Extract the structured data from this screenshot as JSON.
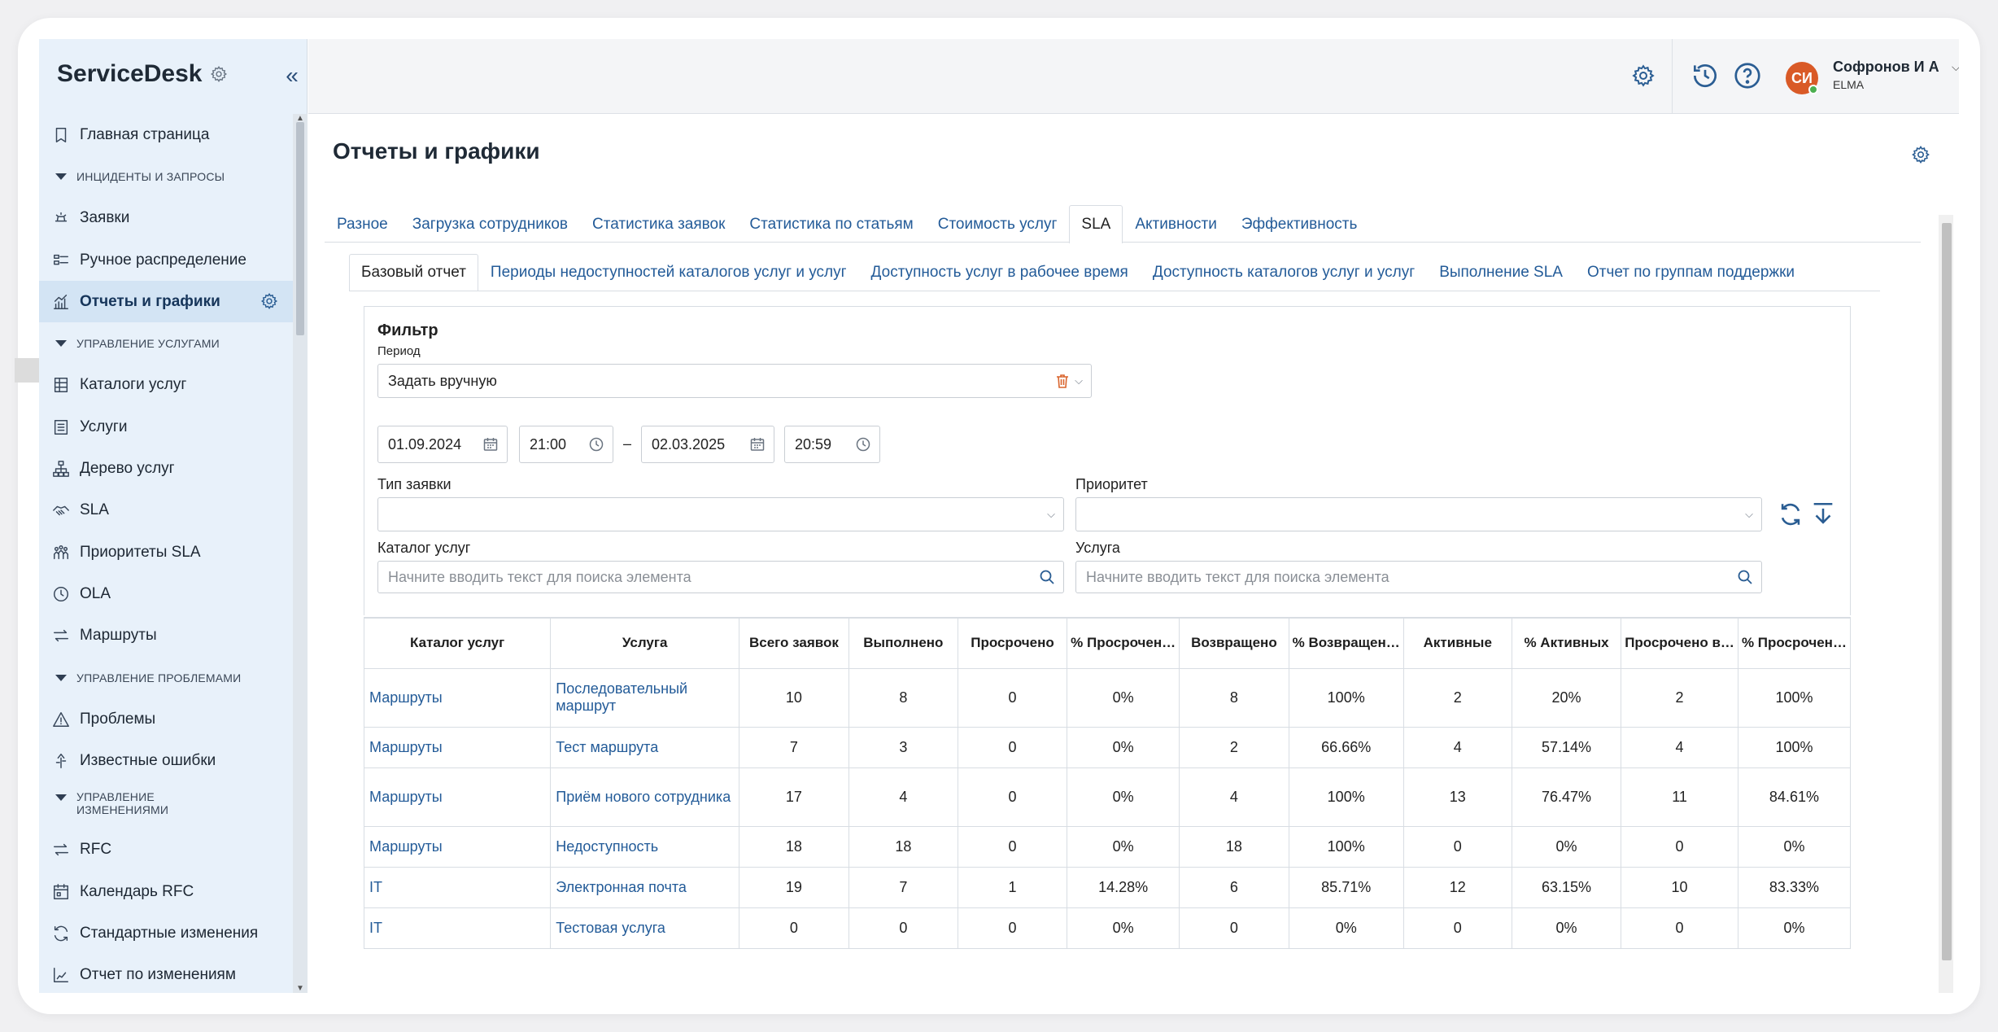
{
  "app": {
    "brand": "ServiceDesk"
  },
  "sidebar": {
    "items": [
      {
        "kind": "item",
        "label": "Главная страница",
        "icon": "bookmark-icon",
        "name": "sidebar-item-home"
      },
      {
        "kind": "section",
        "label": "Инциденты и запросы",
        "name": "sidebar-section-incidents"
      },
      {
        "kind": "item",
        "label": "Заявки",
        "icon": "requests-icon",
        "name": "sidebar-item-requests"
      },
      {
        "kind": "item",
        "label": "Ручное распределение",
        "icon": "distribution-icon",
        "name": "sidebar-item-distribution"
      },
      {
        "kind": "item",
        "label": "Отчеты и графики",
        "icon": "chart-icon",
        "name": "sidebar-item-reports",
        "active": true
      },
      {
        "kind": "section",
        "label": "Управление услугами",
        "name": "sidebar-section-services"
      },
      {
        "kind": "item",
        "label": "Каталоги услуг",
        "icon": "catalog-icon",
        "name": "sidebar-item-catalogs"
      },
      {
        "kind": "item",
        "label": "Услуги",
        "icon": "list-icon",
        "name": "sidebar-item-services"
      },
      {
        "kind": "item",
        "label": "Дерево услуг",
        "icon": "tree-icon",
        "name": "sidebar-item-service-tree"
      },
      {
        "kind": "item",
        "label": "SLA",
        "icon": "handshake-icon",
        "name": "sidebar-item-sla"
      },
      {
        "kind": "item",
        "label": "Приоритеты SLA",
        "icon": "priority-icon",
        "name": "sidebar-item-sla-priorities"
      },
      {
        "kind": "item",
        "label": "OLA",
        "icon": "clock-icon",
        "name": "sidebar-item-ola"
      },
      {
        "kind": "item",
        "label": "Маршруты",
        "icon": "routes-icon",
        "name": "sidebar-item-routes"
      },
      {
        "kind": "section",
        "label": "Управление проблемами",
        "name": "sidebar-section-problems"
      },
      {
        "kind": "item",
        "label": "Проблемы",
        "icon": "warning-icon",
        "name": "sidebar-item-problems"
      },
      {
        "kind": "item",
        "label": "Известные ошибки",
        "icon": "known-error-icon",
        "name": "sidebar-item-known-errors"
      },
      {
        "kind": "section2",
        "label": "Управление изменениями",
        "name": "sidebar-section-changes"
      },
      {
        "kind": "item",
        "label": "RFC",
        "icon": "swap-icon",
        "name": "sidebar-item-rfc"
      },
      {
        "kind": "item",
        "label": "Календарь RFC",
        "icon": "calendar-icon",
        "name": "sidebar-item-rfc-calendar"
      },
      {
        "kind": "item",
        "label": "Стандартные изменения",
        "icon": "refresh-icon",
        "name": "sidebar-item-standard-changes"
      },
      {
        "kind": "item",
        "label": "Отчет по изменениям",
        "icon": "report-icon",
        "name": "sidebar-item-change-report"
      }
    ]
  },
  "header": {
    "user_name": "Софронов И А",
    "user_org": "ELMA",
    "avatar_initials": "СИ",
    "avatar_color": "#d95a27"
  },
  "page": {
    "title": "Отчеты и графики"
  },
  "tabs": [
    {
      "label": "Разное"
    },
    {
      "label": "Загрузка сотрудников"
    },
    {
      "label": "Статистика заявок"
    },
    {
      "label": "Статистика по статьям"
    },
    {
      "label": "Стоимость услуг"
    },
    {
      "label": "SLA",
      "active": true
    },
    {
      "label": "Активности"
    },
    {
      "label": "Эффективность"
    }
  ],
  "subtabs": [
    {
      "label": "Базовый отчет",
      "active": true
    },
    {
      "label": "Периоды недоступностей каталогов услуг и услуг"
    },
    {
      "label": "Доступность услуг в рабочее время"
    },
    {
      "label": "Доступность каталогов услуг и услуг"
    },
    {
      "label": "Выполнение SLA"
    },
    {
      "label": "Отчет по группам поддержки"
    }
  ],
  "filter": {
    "title": "Фильтр",
    "period_label": "Период",
    "period_value": "Задать вручную",
    "date_from": "01.09.2024",
    "time_from": "21:00",
    "range_dash": "–",
    "date_to": "02.03.2025",
    "time_to": "20:59",
    "type_label": "Тип заявки",
    "type_value": "",
    "priority_label": "Приоритет",
    "priority_value": "",
    "catalog_label": "Каталог услуг",
    "catalog_placeholder": "Начните вводить текст для поиска элемента",
    "service_label": "Услуга",
    "service_placeholder": "Начните вводить текст для поиска элемента"
  },
  "table": {
    "columns": [
      "Каталог услуг",
      "Услуга",
      "Всего заявок",
      "Выполнено",
      "Просрочено",
      "% Просрочен…",
      "Возвращено",
      "% Возвращен…",
      "Активные",
      "% Активных",
      "Просрочено в…",
      "% Просрочен…"
    ],
    "rows": [
      [
        "Маршруты",
        "Последовательный маршрут",
        "10",
        "8",
        "0",
        "0%",
        "8",
        "100%",
        "2",
        "20%",
        "2",
        "100%"
      ],
      [
        "Маршруты",
        "Тест маршрута",
        "7",
        "3",
        "0",
        "0%",
        "2",
        "66.66%",
        "4",
        "57.14%",
        "4",
        "100%"
      ],
      [
        "Маршруты",
        "Приём нового сотрудника",
        "17",
        "4",
        "0",
        "0%",
        "4",
        "100%",
        "13",
        "76.47%",
        "11",
        "84.61%"
      ],
      [
        "Маршруты",
        "Недоступность",
        "18",
        "18",
        "0",
        "0%",
        "18",
        "100%",
        "0",
        "0%",
        "0",
        "0%"
      ],
      [
        "IT",
        "Электронная почта",
        "19",
        "7",
        "1",
        "14.28%",
        "6",
        "85.71%",
        "12",
        "63.15%",
        "10",
        "83.33%"
      ],
      [
        "IT",
        "Тестовая услуга",
        "0",
        "0",
        "0",
        "0%",
        "0",
        "0%",
        "0",
        "0%",
        "0",
        "0%"
      ]
    ]
  },
  "colors": {
    "accent": "#235b98",
    "sidebar_bg": "#e8f1fa",
    "active_bg": "#d3e4f4"
  }
}
